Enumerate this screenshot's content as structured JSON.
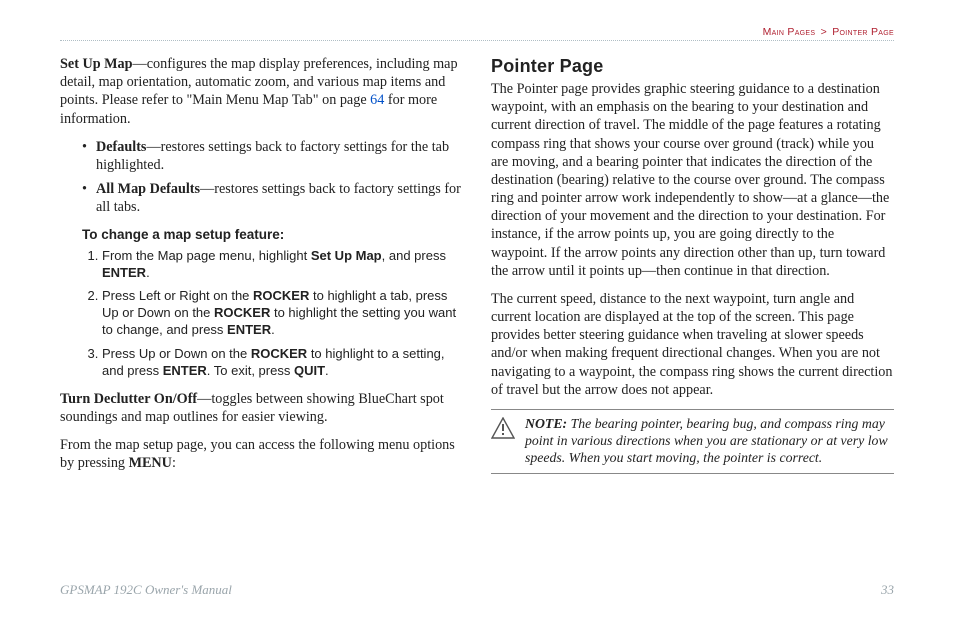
{
  "breadcrumb": {
    "section": "Main Pages",
    "sep": ">",
    "page": "Pointer Page"
  },
  "left": {
    "p1": {
      "lead": "Set Up Map",
      "body1": "—configures the map display preferences, including map detail, map orientation, automatic zoom, and various map items and points. Please refer to \"Main Menu Map Tab\" on page ",
      "link": "64",
      "body2": " for more information."
    },
    "bullets": [
      {
        "lead": "Defaults",
        "text": "—restores settings back to factory settings for the tab highlighted."
      },
      {
        "lead": "All Map Defaults",
        "text": "—restores settings back to factory settings for all tabs."
      }
    ],
    "procedure": {
      "title": "To change a map setup feature:",
      "steps": [
        {
          "a": "From the Map page menu, highlight ",
          "b1": "Set Up Map",
          "c": ", and press ",
          "b2": "ENTER",
          "d": "."
        },
        {
          "a": "Press Left or Right on the ",
          "b1": "ROCKER",
          "c": " to highlight a tab, press Up or Down on the ",
          "b2": "ROCKER",
          "d": " to highlight the setting you want to change, and press ",
          "b3": "ENTER",
          "e": "."
        },
        {
          "a": "Press Up or Down on the ",
          "b1": "ROCKER",
          "c": " to highlight to a setting, and press ",
          "b2": "ENTER",
          "d": ". To exit, press ",
          "b3": "QUIT",
          "e": "."
        }
      ]
    },
    "p2": {
      "lead": "Turn Declutter On/Off",
      "body": "—toggles between showing BlueChart spot soundings and map outlines for easier viewing."
    },
    "p3": {
      "a": "From the map setup page, you can access the following menu options by pressing ",
      "b": "MENU",
      "c": ":"
    }
  },
  "right": {
    "heading": "Pointer Page",
    "p1": "The Pointer page provides graphic steering guidance to a destination waypoint, with an emphasis on the bearing to your destination and current direction of travel. The middle of the page features a rotating compass ring that shows your course over ground (track) while you are moving, and a bearing pointer that indicates the direction of the destination (bearing) relative to the course over ground. The compass ring and pointer arrow work independently to show—at a glance—the direction of your movement and the direction to your destination. For instance, if the arrow points up, you are going directly to the waypoint. If the arrow points any direction other than up, turn toward the arrow until it points up—then continue in that direction.",
    "p2": "The current speed, distance to the next waypoint, turn angle and current location are displayed at the top of the screen. This page provides better steering guidance when traveling at slower speeds and/or when making frequent directional changes. When you are not navigating to a waypoint, the compass ring shows the current direction of travel but the arrow does not appear.",
    "note": {
      "lead": "NOTE:",
      "body": " The bearing pointer, bearing bug, and compass ring may point in various directions when you are stationary or at very low speeds. When you start moving, the pointer is correct."
    }
  },
  "footer": {
    "manual": "GPSMAP 192C Owner's Manual",
    "page": "33"
  }
}
